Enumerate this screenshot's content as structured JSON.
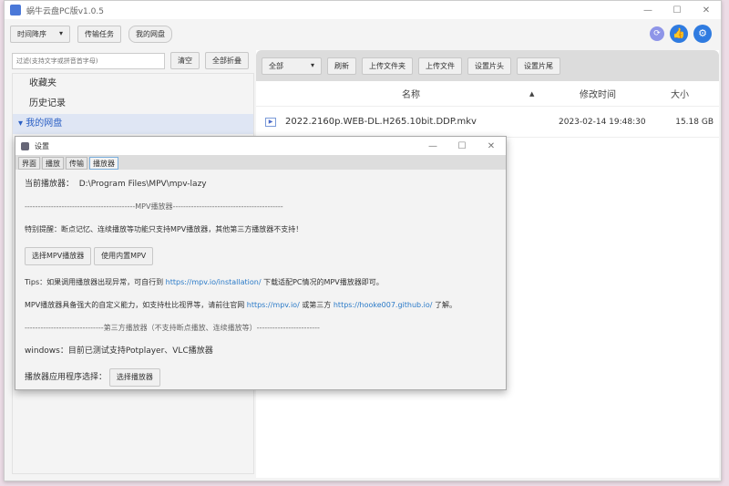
{
  "app": {
    "title": "蜗牛云盘PC版v1.0.5",
    "min": "—",
    "max": "☐",
    "close": "✕"
  },
  "toolbar": {
    "sort": "时间降序",
    "tasks": "传输任务",
    "mydisk": "我的网盘"
  },
  "left": {
    "filter_placeholder": "过滤(支持文字或拼音首字母)",
    "clear": "清空",
    "collapse": "全部折叠",
    "tree": [
      "收藏夹",
      "历史记录",
      "我的网盘"
    ]
  },
  "right": {
    "filter": "全部",
    "buttons": [
      "刷新",
      "上传文件夹",
      "上传文件",
      "设置片头",
      "设置片尾"
    ],
    "columns": {
      "name": "名称",
      "sort": "▲",
      "modified": "修改时间",
      "size": "大小"
    },
    "files": [
      {
        "name": "2022.2160p.WEB-DL.H265.10bit.DDP.mkv",
        "modified": "2023-02-14 19:48:30",
        "size": "15.18 GB"
      }
    ]
  },
  "dialog": {
    "title": "设置",
    "tabs": [
      "界面",
      "播放",
      "传输",
      "播放器"
    ],
    "current_label": "当前播放器：",
    "current_path": "D:\\Program Files\\MPV\\mpv-lazy",
    "mpv_sep": "------------------------------------------MPV播放器------------------------------------------",
    "notice": "特别提醒：断点记忆、连续播放等功能只支持MPV播放器，其他第三方播放器不支持！",
    "select_mpv": "选择MPV播放器",
    "use_builtin": "使用内置MPV",
    "tips_a": "Tips：如果调用播放器出现异常，可自行到",
    "tips_link": "https://mpv.io/installation/",
    "tips_b": "下载适配PC情况的MPV播放器即可。",
    "mpv_a": "MPV播放器具备强大的自定义能力，如支持杜比视界等，请前往官网",
    "mpv_link1": "https://mpv.io/",
    "mpv_b": "或第三方",
    "mpv_link2": "https://hooke007.github.io/",
    "mpv_c": "了解。",
    "third_sep": "------------------------------第三方播放器（不支持断点播放、连续播放等）------------------------",
    "windows": "windows：目前已测试支持Potplayer、VLC播放器",
    "app_label": "播放器应用程序选择：",
    "choose": "选择播放器"
  },
  "icons": [
    "refresh-icon",
    "thumbs-up-icon",
    "gear-icon"
  ],
  "colors": {
    "accent": "#2f7be0",
    "link": "#2a7ac8"
  }
}
